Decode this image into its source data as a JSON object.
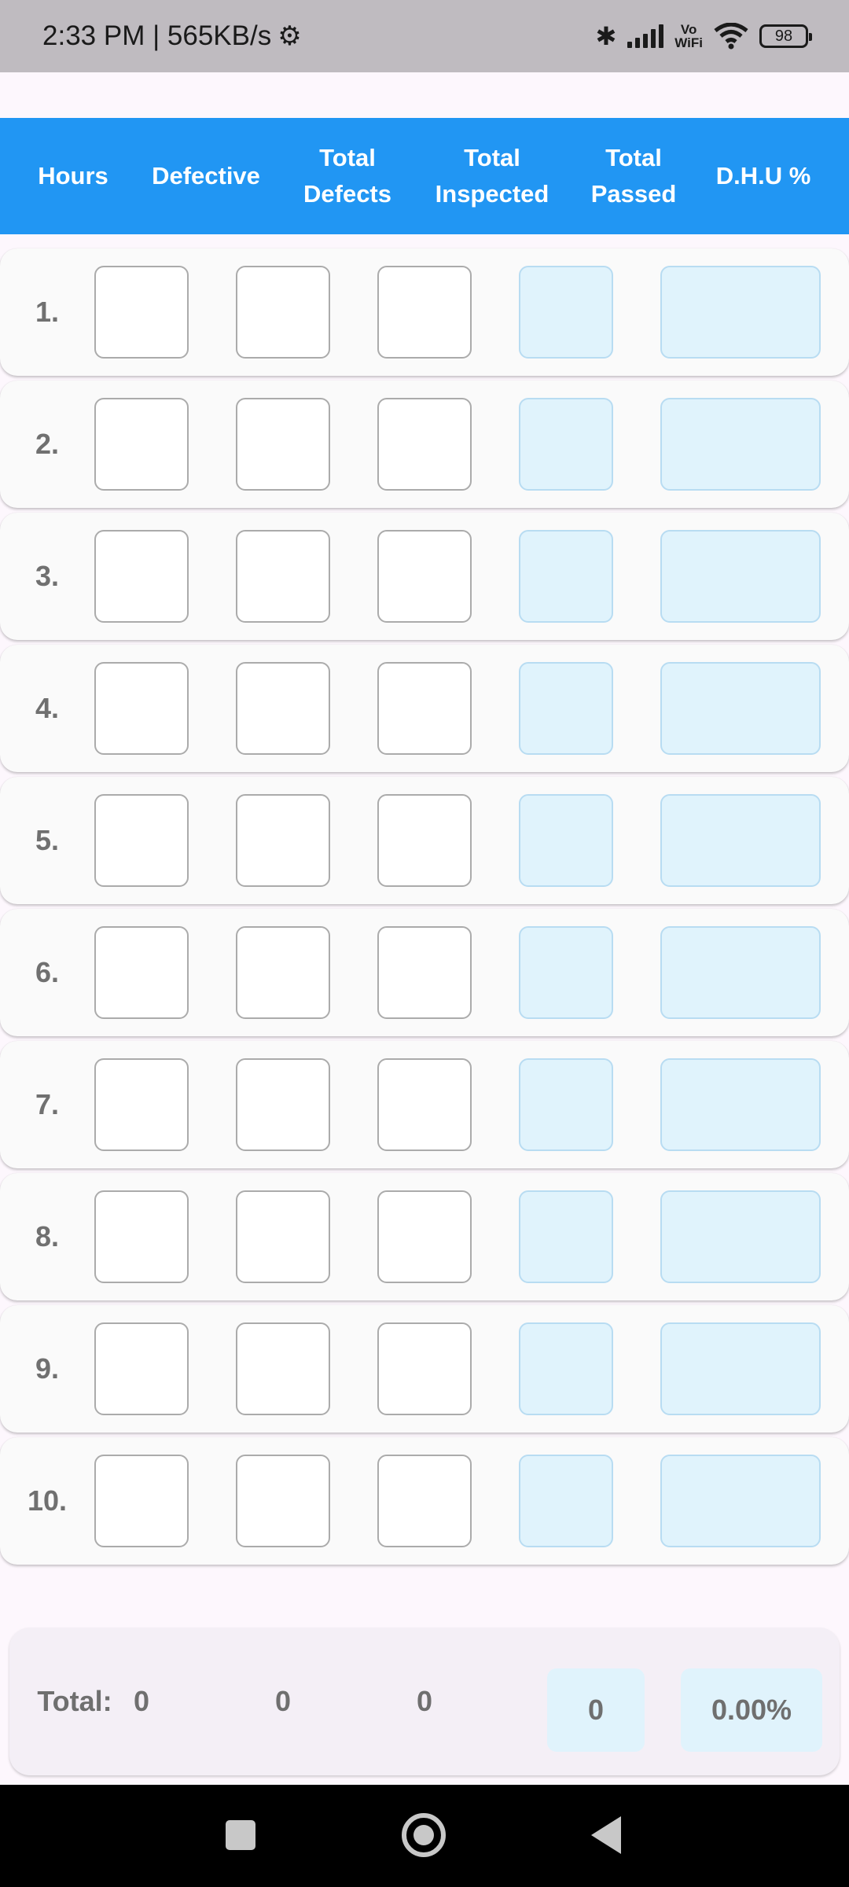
{
  "status_bar": {
    "time_speed": "2:33 PM | 565KB/s",
    "gear_icon": "⚙",
    "bluetooth_icon": "✱",
    "vowifi_top": "Vo",
    "vowifi_bottom": "WiFi",
    "battery": "98"
  },
  "header": {
    "col1": "Hours",
    "col2": "Defective",
    "col3": "Total\nDefects",
    "col4": "Total\nInspected",
    "col5": "Total\nPassed",
    "col6": "D.H.U %"
  },
  "rows": [
    {
      "label": "1."
    },
    {
      "label": "2."
    },
    {
      "label": "3."
    },
    {
      "label": "4."
    },
    {
      "label": "5."
    },
    {
      "label": "6."
    },
    {
      "label": "7."
    },
    {
      "label": "8."
    },
    {
      "label": "9."
    },
    {
      "label": "10."
    }
  ],
  "totals": {
    "label": "Total:",
    "defective": "0",
    "total_defects": "0",
    "total_inspected": "0",
    "total_passed": "0",
    "dhu": "0.00%"
  },
  "colors": {
    "header_bg": "#2196f3",
    "computed_cell_bg": "#e0f3fc",
    "computed_cell_border": "#b8dcf2"
  }
}
